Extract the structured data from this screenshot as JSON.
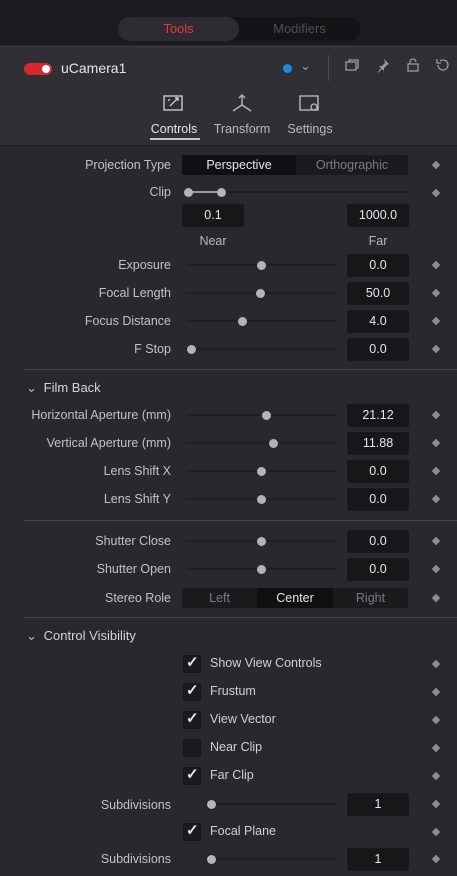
{
  "top_tabs": {
    "tools": "Tools",
    "modifiers": "Modifiers"
  },
  "header": {
    "node_name": "uCamera1",
    "color_chip": "#1e8ad6",
    "toggle_color": "#d8282c"
  },
  "inspector_tabs": [
    {
      "label": "Controls",
      "icon": "controls-icon",
      "active": true
    },
    {
      "label": "Transform",
      "icon": "transform-icon",
      "active": false
    },
    {
      "label": "Settings",
      "icon": "settings-icon",
      "active": false
    }
  ],
  "projection": {
    "label": "Projection Type",
    "options": [
      "Perspective",
      "Orthographic"
    ],
    "selected": "Perspective"
  },
  "clip": {
    "label": "Clip",
    "near_value": "0.1",
    "far_value": "1000.0",
    "near_label": "Near",
    "far_label": "Far"
  },
  "params_top": [
    {
      "label": "Exposure",
      "value": "0.0",
      "slider_frac": 0.5
    },
    {
      "label": "Focal Length",
      "value": "50.0",
      "slider_frac": 0.49
    },
    {
      "label": "Focus Distance",
      "value": "4.0",
      "slider_frac": 0.37
    },
    {
      "label": "F Stop",
      "value": "0.0",
      "slider_frac": 0.03
    }
  ],
  "film_back": {
    "title": "Film Back",
    "params": [
      {
        "label": "Horizontal Aperture (mm)",
        "value": "21.12",
        "slider_frac": 0.53
      },
      {
        "label": "Vertical Aperture (mm)",
        "value": "11.88",
        "slider_frac": 0.58
      },
      {
        "label": "Lens Shift X",
        "value": "0.0",
        "slider_frac": 0.5
      },
      {
        "label": "Lens Shift Y",
        "value": "0.0",
        "slider_frac": 0.5
      }
    ]
  },
  "shutter": [
    {
      "label": "Shutter Close",
      "value": "0.0",
      "slider_frac": 0.5
    },
    {
      "label": "Shutter Open",
      "value": "0.0",
      "slider_frac": 0.5
    }
  ],
  "stereo": {
    "label": "Stereo Role",
    "options": [
      "Left",
      "Center",
      "Right"
    ],
    "selected": "Center"
  },
  "control_visibility": {
    "title": "Control Visibility",
    "items": [
      {
        "label": "Show View Controls",
        "checked": true
      },
      {
        "label": "Frustum",
        "checked": true
      },
      {
        "label": "View Vector",
        "checked": true
      },
      {
        "label": "Near Clip",
        "checked": false
      },
      {
        "label": "Far Clip",
        "checked": true
      }
    ],
    "subdivisions_1": {
      "label": "Subdivisions",
      "value": "1"
    },
    "focal_plane": {
      "label": "Focal Plane",
      "checked": true
    },
    "subdivisions_2": {
      "label": "Subdivisions",
      "value": "1"
    }
  }
}
